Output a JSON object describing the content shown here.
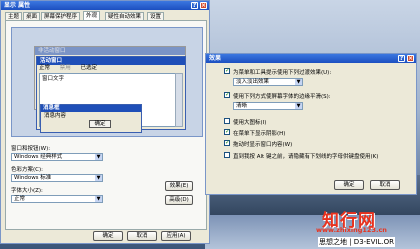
{
  "display": {
    "title": "显示 属性",
    "tabs": [
      "主题",
      "桌面",
      "屏幕保护程序",
      "外观",
      "疑性自动效果",
      "设置"
    ],
    "preview": {
      "inactive_title": "非活动窗口",
      "active_title": "活动窗口",
      "menu": [
        "正常",
        "禁用",
        "已选定"
      ],
      "window_text": "窗口文字",
      "msg_title": "消息框",
      "msg_text": "消息内容",
      "ok": "确定"
    },
    "window_style_label": "窗口和按钮(W):",
    "window_style_value": "Windows 经典样式",
    "color_scheme_label": "色彩方案(C):",
    "color_scheme_value": "Windows 标准",
    "font_size_label": "字体大小(Z):",
    "font_size_value": "正常",
    "effects_btn": "效果(E)",
    "advanced_btn": "高级(D)",
    "ok": "确定",
    "cancel": "取消",
    "apply": "应用(A)"
  },
  "effects": {
    "title": "效果",
    "options": [
      {
        "label": "为菜单和工具提示使用下列过渡效果(U):",
        "checked": true
      },
      {
        "label": "使用下列方式使屏幕字体的边缘平滑(S):",
        "checked": true
      },
      {
        "label": "使用大图标(I)",
        "checked": false
      },
      {
        "label": "在菜单下显示阴影(H)",
        "checked": true
      },
      {
        "label": "拖动时显示窗口内容(W)",
        "checked": true
      },
      {
        "label": "直到我按 Alt 键之前，请隐藏有下划线的字母供键盘使用(K)",
        "checked": false
      }
    ],
    "transition_value": "淡入淡出效果",
    "smoothing_value": "清晰",
    "ok": "确定",
    "cancel": "取消"
  },
  "watermark": {
    "name": "知行网",
    "url": "www.zhixing123.cn",
    "footer": "思想之地 | D3-EVIL.OR"
  }
}
